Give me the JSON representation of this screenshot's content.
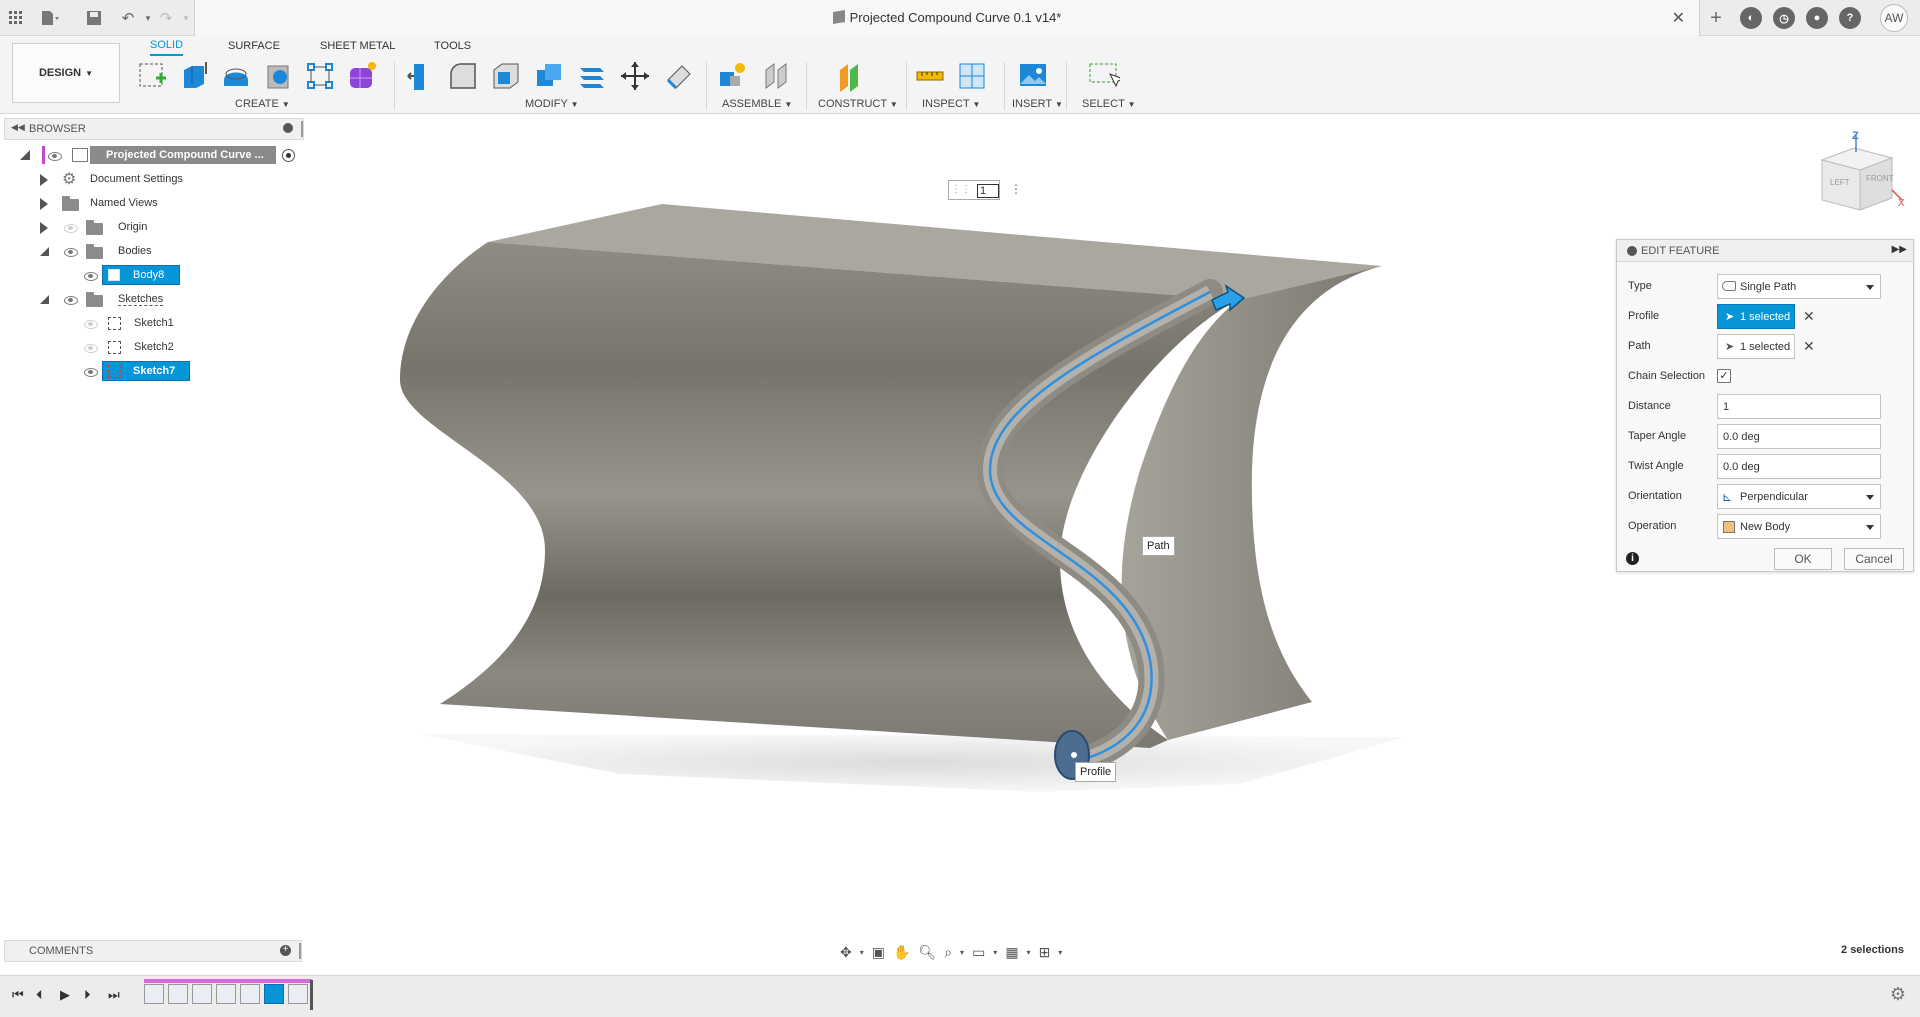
{
  "app": {
    "document_title": "Projected Compound Curve 0.1 v14*",
    "user_initials": "AW",
    "workspace": "DESIGN"
  },
  "ribbon": {
    "tabs": [
      {
        "label": "SOLID",
        "active": true
      },
      {
        "label": "SURFACE",
        "active": false
      },
      {
        "label": "SHEET METAL",
        "active": false
      },
      {
        "label": "TOOLS",
        "active": false
      }
    ],
    "groups": {
      "create": "CREATE",
      "modify": "MODIFY",
      "assemble": "ASSEMBLE",
      "construct": "CONSTRUCT",
      "inspect": "INSPECT",
      "insert": "INSERT",
      "select": "SELECT"
    }
  },
  "browser": {
    "title": "BROWSER",
    "root": "Projected Compound Curve ...",
    "items": [
      {
        "label": "Document Settings"
      },
      {
        "label": "Named Views"
      },
      {
        "label": "Origin"
      },
      {
        "label": "Bodies"
      },
      {
        "label": "Body8"
      },
      {
        "label": "Sketches"
      },
      {
        "label": "Sketch1"
      },
      {
        "label": "Sketch2"
      },
      {
        "label": "Sketch7"
      }
    ]
  },
  "comments": {
    "title": "COMMENTS"
  },
  "viewport": {
    "distance_input": "1",
    "path_label": "Path",
    "profile_label": "Profile",
    "viewcube": {
      "left": "LEFT",
      "front": "FRONT",
      "z": "Z",
      "x": "X"
    }
  },
  "edit_feature": {
    "title": "EDIT FEATURE",
    "type_label": "Type",
    "type_value": "Single Path",
    "profile_label": "Profile",
    "profile_value": "1 selected",
    "path_label": "Path",
    "path_value": "1 selected",
    "chain_label": "Chain Selection",
    "chain_checked": true,
    "distance_label": "Distance",
    "distance_value": "1",
    "taper_label": "Taper Angle",
    "taper_value": "0.0 deg",
    "twist_label": "Twist Angle",
    "twist_value": "0.0 deg",
    "orientation_label": "Orientation",
    "orientation_value": "Perpendicular",
    "operation_label": "Operation",
    "operation_value": "New Body",
    "ok_label": "OK",
    "cancel_label": "Cancel"
  },
  "status": {
    "selections": "2 selections"
  },
  "colors": {
    "accent": "#0696d7",
    "body_face": "#8a877e",
    "top_face": "#a9a79f"
  }
}
